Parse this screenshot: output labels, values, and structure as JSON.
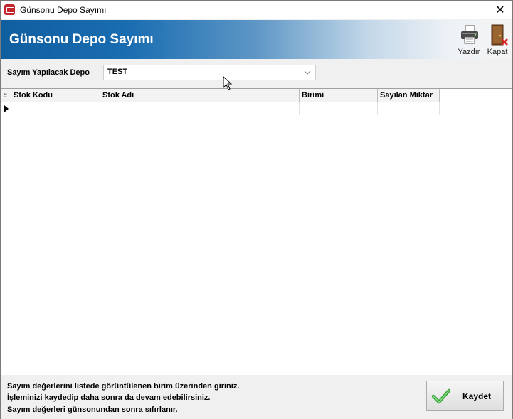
{
  "window": {
    "title": "Günsonu Depo Sayımı",
    "close_glyph": "✕"
  },
  "banner": {
    "title": "Günsonu Depo Sayımı",
    "tools": {
      "print_label": "Yazdır",
      "close_label": "Kapat"
    }
  },
  "depo": {
    "label": "Sayım Yapılacak Depo",
    "value": "TEST"
  },
  "grid": {
    "selector_glyph": "::",
    "columns": [
      "Stok Kodu",
      "Stok Adı",
      "Birimi",
      "Sayılan Miktar"
    ]
  },
  "footer": {
    "notes": [
      "Sayım değerlerini listede görüntülenen birim üzerinden giriniz.",
      "İşleminizi kaydedip daha sonra da devam edebilirsiniz.",
      "Sayım değerleri günsonundan sonra sıfırlanır."
    ],
    "save_label": "Kaydet"
  },
  "colors": {
    "banner_start": "#0f5ea0",
    "banner_end": "#f4f4f4",
    "check": "#3aa23a"
  }
}
